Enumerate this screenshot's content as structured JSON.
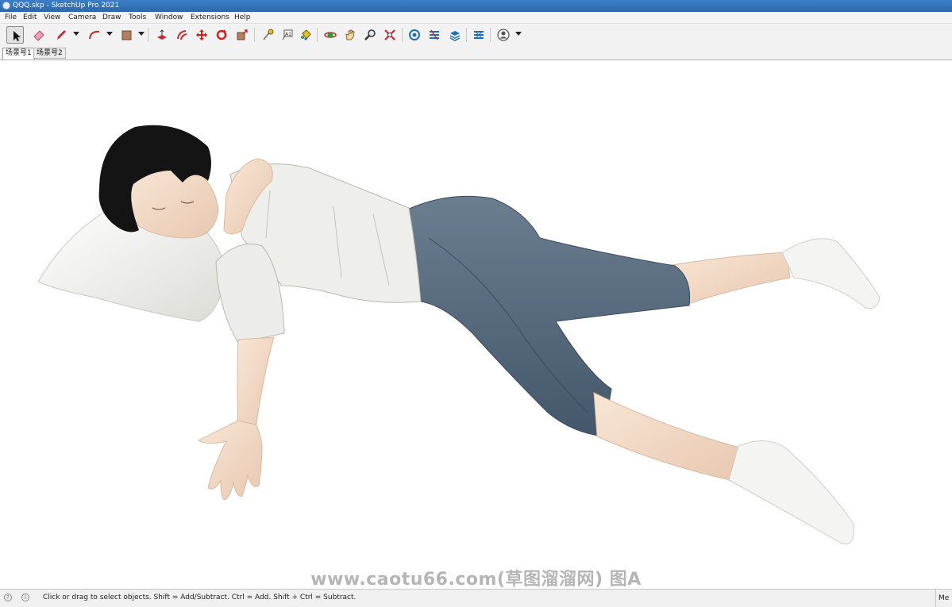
{
  "window": {
    "title": "QQQ.skp - SketchUp Pro 2021"
  },
  "menu": [
    "File",
    "Edit",
    "View",
    "Camera",
    "Draw",
    "Tools",
    "Window",
    "Extensions",
    "Help"
  ],
  "toolbar": {
    "tools": [
      "select",
      "eraser",
      "line",
      "arc",
      "rectangle",
      "push-pull",
      "offset",
      "move",
      "rotate",
      "scale",
      "tape-measure",
      "text",
      "paint-bucket",
      "orbit",
      "pan",
      "zoom",
      "zoom-extents",
      "3d-warehouse",
      "extension-warehouse",
      "layout",
      "extension-manager",
      "account"
    ]
  },
  "scenes": {
    "tabs": [
      "场景号1",
      "场景号2"
    ],
    "selected_index": 0
  },
  "viewport": {
    "watermark": "www.caotu66.com(草图溜溜网) 图A"
  },
  "status": {
    "message": "Click or drag to select objects. Shift = Add/Subtract. Ctrl = Add. Shift + Ctrl = Subtract.",
    "measurements_label": "Me"
  },
  "colors": {
    "titlebar": "#2a68ae",
    "jeans": "#56697a",
    "skin": "#f4dcc8",
    "shirt": "#eeeeea",
    "hair": "#111111"
  }
}
